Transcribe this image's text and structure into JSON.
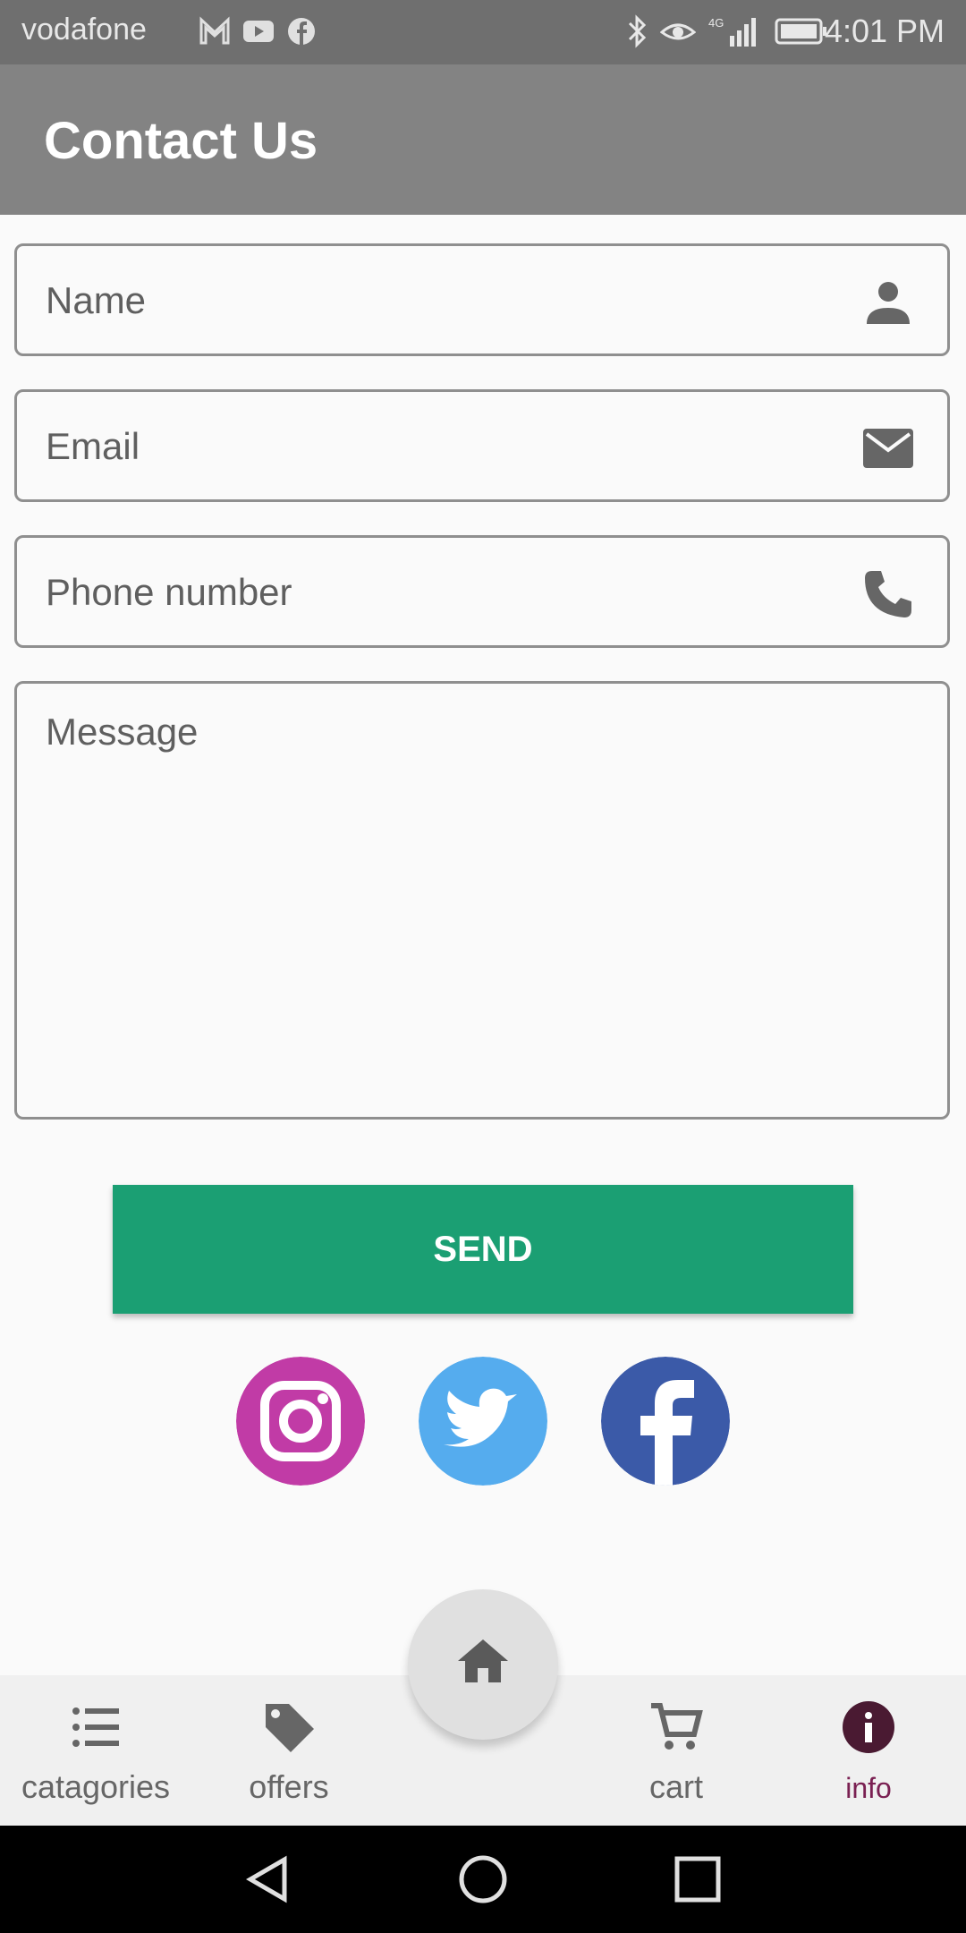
{
  "status_bar": {
    "carrier": "vodafone",
    "time": "4:01 PM",
    "notification_icons": [
      "gmail-icon",
      "youtube-icon",
      "facebook-icon"
    ],
    "system_icons": [
      "bluetooth-icon",
      "eye-comfort-icon",
      "signal-4g-icon",
      "battery-icon"
    ]
  },
  "app_bar": {
    "title": "Contact Us"
  },
  "form": {
    "name_placeholder": "Name",
    "email_placeholder": "Email",
    "phone_placeholder": "Phone number",
    "message_placeholder": "Message",
    "send_label": "SEND"
  },
  "social": [
    "instagram-icon",
    "twitter-icon",
    "facebook-icon"
  ],
  "bottom_nav": {
    "items": [
      {
        "label": "catagories",
        "icon": "list-icon"
      },
      {
        "label": "offers",
        "icon": "tag-icon"
      },
      {
        "label": "cart",
        "icon": "cart-icon"
      },
      {
        "label": "info",
        "icon": "info-icon"
      }
    ],
    "home_icon": "home-icon"
  },
  "colors": {
    "status_bar": "#6f6f6f",
    "app_bar": "#838383",
    "send_button": "#1b9f73",
    "active_nav": "#7a2052",
    "instagram": "#c13ba6",
    "twitter": "#55acee",
    "facebook": "#3b5aa8"
  }
}
